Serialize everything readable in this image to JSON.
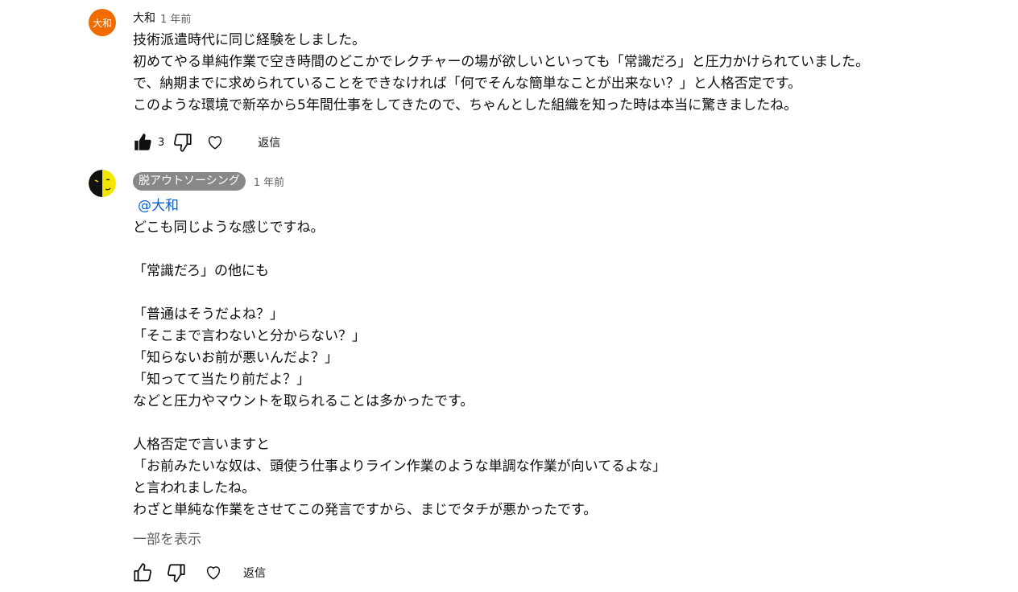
{
  "comments": [
    {
      "avatar_text": "大和",
      "author": "大和",
      "time": "1 年前",
      "lines": [
        "技術派遣時代に同じ経験をしました。",
        "初めてやる単純作業で空き時間のどこかでレクチャーの場が欲しいといっても「常識だろ」と圧力かけられていました。",
        "で、納期までに求められていることをできなければ「何でそんな簡単なことが出来ない？」と人格否定です。",
        "このような環境で新卒から5年間仕事をしてきたので、ちゃんとした組織を知った時は本当に驚きましたね。"
      ],
      "likes": "3",
      "reply_label": "返信"
    },
    {
      "author": "脱アウトソーシング",
      "time": "1 年前",
      "mention": "@大和",
      "lines": [
        "どこも同じような感じですね。",
        "",
        "「常識だろ」の他にも",
        "",
        "「普通はそうだよね？」",
        "「そこまで言わないと分からない？」",
        "「知らないお前が悪いんだよ？」",
        "「知ってて当たり前だよ？」",
        "などと圧力やマウントを取られることは多かったです。",
        "",
        "人格否定で言いますと",
        "「お前みたいな奴は、頭使う仕事よりライン作業のような単調な作業が向いてるよな」",
        "と言われましたね。",
        "わざと単純な作業をさせてこの発言ですから、まじでタチが悪かったです。"
      ],
      "show_more": "一部を表示",
      "reply_label": "返信"
    }
  ]
}
